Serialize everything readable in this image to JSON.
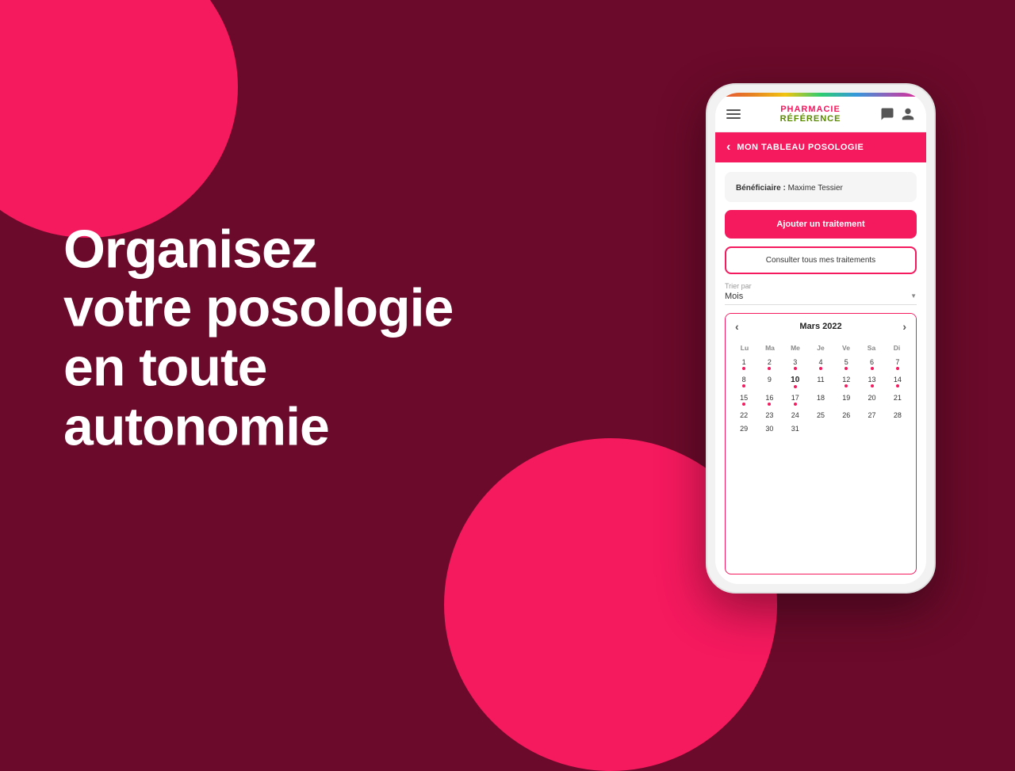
{
  "background": {
    "color": "#6b0a2a"
  },
  "hero": {
    "line1": "Organisez",
    "line2": "votre posologie",
    "line3": "en toute autonomie"
  },
  "phone": {
    "logo": {
      "line1": "PHARMACIE",
      "line2": "RÉFÉRENCE"
    },
    "nav_title": "MON TABLEAU POSOLOGIE",
    "back_arrow": "‹",
    "beneficiaire_label": "Bénéficiaire :",
    "beneficiaire_name": "Maxime Tessier",
    "btn_add": "Ajouter un traitement",
    "btn_consult": "Consulter tous mes traitements",
    "sort_label": "Trier par",
    "sort_value": "Mois",
    "calendar": {
      "month_year": "Mars 2022",
      "day_names": [
        "Lu",
        "Ma",
        "Me",
        "Je",
        "Ve",
        "Sa",
        "Di"
      ],
      "weeks": [
        [
          {
            "num": "1",
            "dot": true,
            "empty": false,
            "today": false
          },
          {
            "num": "2",
            "dot": true,
            "empty": false,
            "today": false
          },
          {
            "num": "3",
            "dot": true,
            "empty": false,
            "today": false
          },
          {
            "num": "4",
            "dot": true,
            "empty": false,
            "today": false
          },
          {
            "num": "5",
            "dot": true,
            "empty": false,
            "today": false
          },
          {
            "num": "6",
            "dot": true,
            "empty": false,
            "today": false
          },
          {
            "num": "7",
            "dot": true,
            "empty": false,
            "today": false
          }
        ],
        [
          {
            "num": "8",
            "dot": true,
            "empty": false,
            "today": false
          },
          {
            "num": "9",
            "dot": false,
            "empty": false,
            "today": false
          },
          {
            "num": "10",
            "dot": true,
            "empty": false,
            "today": true
          },
          {
            "num": "11",
            "dot": false,
            "empty": false,
            "today": false
          },
          {
            "num": "12",
            "dot": true,
            "empty": false,
            "today": false
          },
          {
            "num": "13",
            "dot": true,
            "empty": false,
            "today": false
          },
          {
            "num": "14",
            "dot": true,
            "empty": false,
            "today": false
          }
        ],
        [
          {
            "num": "15",
            "dot": true,
            "empty": false,
            "today": false
          },
          {
            "num": "16",
            "dot": true,
            "empty": false,
            "today": false
          },
          {
            "num": "17",
            "dot": true,
            "empty": false,
            "today": false
          },
          {
            "num": "18",
            "dot": false,
            "empty": false,
            "today": false
          },
          {
            "num": "19",
            "dot": false,
            "empty": false,
            "today": false
          },
          {
            "num": "20",
            "dot": false,
            "empty": false,
            "today": false
          },
          {
            "num": "21",
            "dot": false,
            "empty": false,
            "today": false
          }
        ],
        [
          {
            "num": "22",
            "dot": false,
            "empty": false,
            "today": false
          },
          {
            "num": "23",
            "dot": false,
            "empty": false,
            "today": false
          },
          {
            "num": "24",
            "dot": false,
            "empty": false,
            "today": false
          },
          {
            "num": "25",
            "dot": false,
            "empty": false,
            "today": false
          },
          {
            "num": "26",
            "dot": false,
            "empty": false,
            "today": false
          },
          {
            "num": "27",
            "dot": false,
            "empty": false,
            "today": false
          },
          {
            "num": "28",
            "dot": false,
            "empty": false,
            "today": false
          }
        ],
        [
          {
            "num": "29",
            "dot": false,
            "empty": false,
            "today": false
          },
          {
            "num": "30",
            "dot": false,
            "empty": false,
            "today": false
          },
          {
            "num": "31",
            "dot": false,
            "empty": false,
            "today": false
          },
          {
            "num": "",
            "dot": false,
            "empty": true,
            "today": false
          },
          {
            "num": "",
            "dot": false,
            "empty": true,
            "today": false
          },
          {
            "num": "",
            "dot": false,
            "empty": true,
            "today": false
          },
          {
            "num": "",
            "dot": false,
            "empty": true,
            "today": false
          }
        ]
      ]
    }
  }
}
